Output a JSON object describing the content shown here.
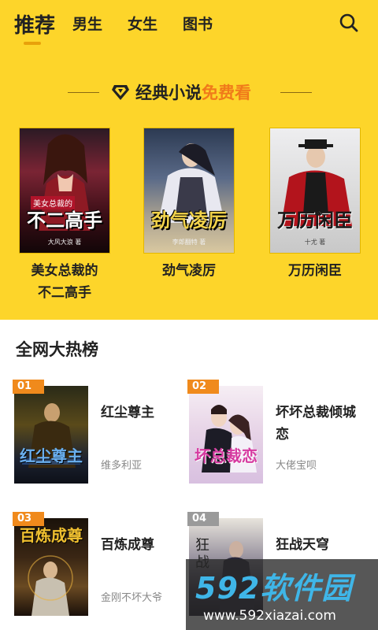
{
  "tabs": [
    {
      "label": "推荐",
      "active": true
    },
    {
      "label": "男生",
      "active": false
    },
    {
      "label": "女生",
      "active": false
    },
    {
      "label": "图书",
      "active": false
    }
  ],
  "icons": {
    "search": "search-icon",
    "diamond": "diamond-icon"
  },
  "promo": {
    "prefix": "经典小说",
    "highlight": "免费看"
  },
  "featured": [
    {
      "title_line1": "美女总裁的",
      "title_line2": "不二高手",
      "cover_text": "不二高手",
      "cover_tag": "美女总裁的",
      "cover_author": "大风大浪 著"
    },
    {
      "title_line1": "劲气凌厉",
      "title_line2": "",
      "cover_text": "劲气凌厉",
      "cover_tag": "",
      "cover_author": "李郎翻特 著"
    },
    {
      "title_line1": "万历闲臣",
      "title_line2": "",
      "cover_text": "万历闲臣",
      "cover_tag": "",
      "cover_author": "十尤 著"
    }
  ],
  "hotlist": {
    "title": "全网大热榜",
    "items": [
      {
        "rank": "01",
        "name": "红尘尊主",
        "author": "维多利亚",
        "cover_text": "红尘尊主"
      },
      {
        "rank": "02",
        "name": "坏坏总裁倾城恋",
        "author": "大佬宝呗",
        "cover_text": "坏总裁恋"
      },
      {
        "rank": "03",
        "name": "百炼成尊",
        "author": "金刚不坏大爷",
        "cover_text": "百炼成尊"
      },
      {
        "rank": "04",
        "name": "狂战天穹",
        "author": "",
        "cover_text": "狂战天穹"
      }
    ]
  },
  "watermark": {
    "logo": "592软件园",
    "url": "www.592xiazai.com"
  },
  "colors": {
    "header_bg": "#fdd52a",
    "indicator": "#e8a10a",
    "highlight": "#f07a1a",
    "badge_orange": "#f08a1c",
    "badge_gray": "#9a9a9a"
  }
}
